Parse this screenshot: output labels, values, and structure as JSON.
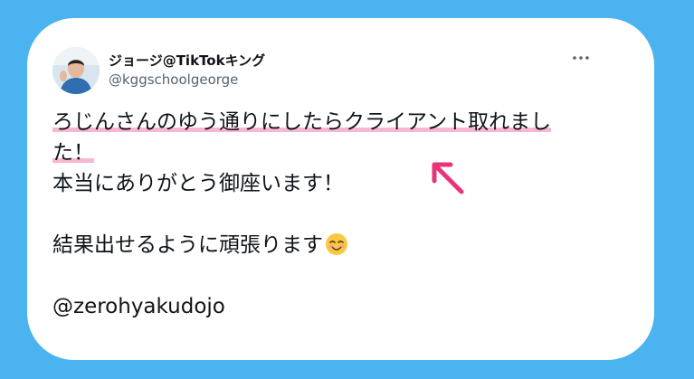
{
  "tweet": {
    "display_name": "ジョージ@TikTokキング",
    "handle": "@kggschoolgeorge",
    "more_icon": "more-horizontal-icon",
    "lines": {
      "line1": "ろじんさんのゆう通りにしたらクライアント取れまし",
      "line2": "た！",
      "line3": "本当にありがとう御座います！",
      "line4": "結果出せるように頑張ります",
      "line5": "@zerohyakudojo"
    },
    "emoji": "smiling-face-icon"
  },
  "colors": {
    "background": "#4bb4f0",
    "highlight": "#f8b6d2",
    "arrow": "#e8357a"
  }
}
